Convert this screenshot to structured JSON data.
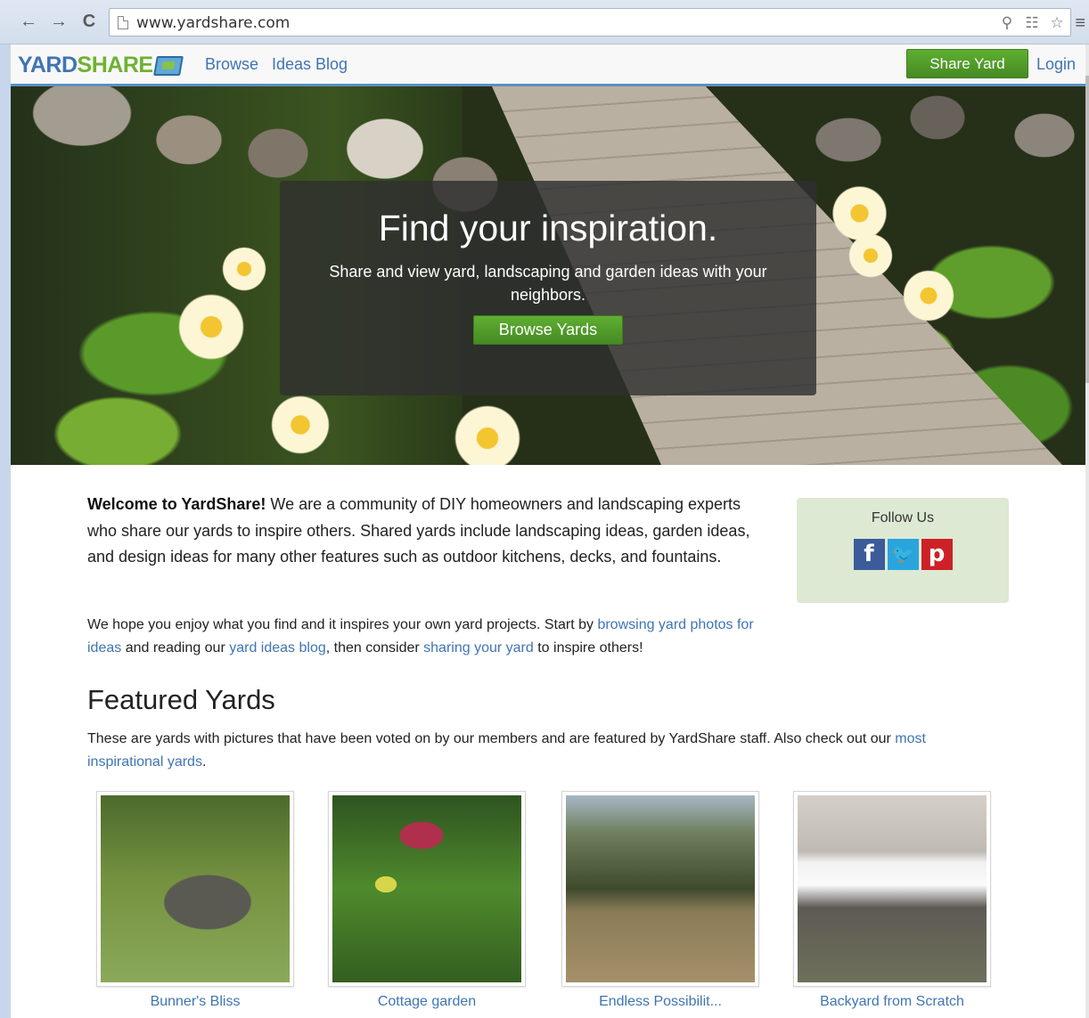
{
  "browser": {
    "url": "www.yardshare.com",
    "back_glyph": "←",
    "forward_glyph": "→",
    "reload_glyph": "C",
    "menu_glyph": "≡",
    "icons": [
      "zoom-icon",
      "translate-icon",
      "star-icon",
      "menu-icon"
    ]
  },
  "header": {
    "logo_yard": "YARD",
    "logo_share": "SHARE",
    "nav": [
      "Browse",
      "Ideas Blog"
    ],
    "share_yard": "Share Yard",
    "login": "Login"
  },
  "hero": {
    "title": "Find your inspiration.",
    "subtitle": "Share and view yard, landscaping and garden ideas with your neighbors.",
    "button": "Browse Yards"
  },
  "welcome": {
    "bold": "Welcome to YardShare!",
    "text": " We are a community of DIY homeowners and landscaping experts who share our yards to inspire others. Shared yards include landscaping ideas, garden ideas, and design ideas for many other features such as outdoor kitchens, decks, and fountains."
  },
  "intro2": {
    "t1": "We hope you enjoy what you find and it inspires your own yard projects. Start by ",
    "l1": "browsing yard photos for ideas",
    "t2": " and reading our ",
    "l2": "yard ideas blog",
    "t3": ", then consider ",
    "l3": "sharing your yard",
    "t4": " to inspire others!"
  },
  "follow": {
    "title": "Follow Us",
    "facebook": "f",
    "twitter": "t",
    "pinterest": "p"
  },
  "featured": {
    "title": "Featured Yards",
    "desc": "These are yards with pictures that have been voted on by our members and are featured by YardShare staff. Also check out our ",
    "desc_link": "most inspirational yards",
    "desc_end": ".",
    "cards": [
      {
        "label": "Bunner's Bliss"
      },
      {
        "label": "Cottage garden"
      },
      {
        "label": "Endless Possibilit..."
      },
      {
        "label": "Backyard from Scratch"
      }
    ]
  },
  "colors": {
    "link": "#3f75b3",
    "green_button": "#55a02b",
    "header_rule": "#5b8fc2",
    "follow_bg": "#dde9d3"
  }
}
